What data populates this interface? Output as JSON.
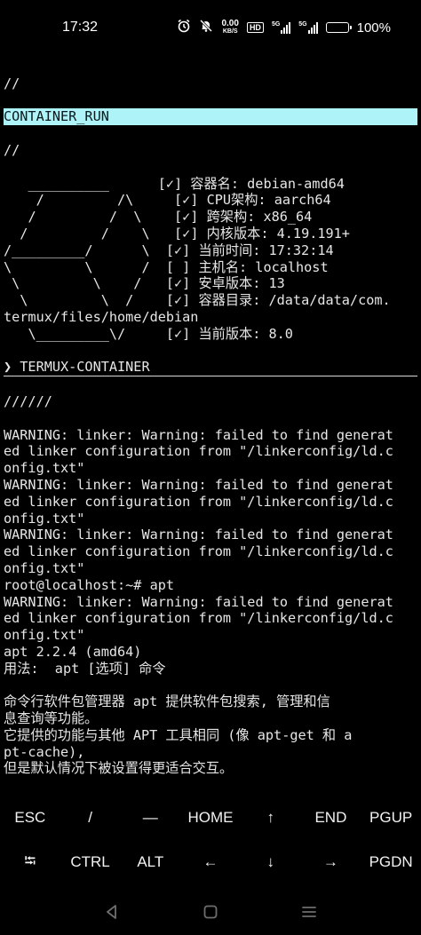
{
  "status_bar": {
    "time": "17:32",
    "net_speed_value": "0.00",
    "net_speed_unit": "KB/S",
    "hd_badge": "HD",
    "signal1_label": "5G",
    "signal2_label": "5G",
    "battery_percent": "100%",
    "battery_level": 1.0
  },
  "terminal": {
    "lines": [
      "",
      "//",
      "",
      "CONTAINER_RUN",
      "",
      "//",
      "",
      "   __________      [✓] 容器名: debian-amd64",
      "    /         /\\     [✓] CPU架构: aarch64",
      "   /         /  \\    [✓] 跨架构: x86_64",
      "  /         /    \\   [✓] 内核版本: 4.19.191+",
      "/_________/      \\  [✓] 当前时间: 17:32:14",
      "\\         \\      /  [ ] 主机名: localhost",
      " \\         \\    /   [✓] 安卓版本: 13",
      "  \\         \\  /    [✓] 容器目录: /data/data/com.",
      "termux/files/home/debian",
      "   \\_________\\/     [✓] 当前版本: 8.0",
      "",
      "❯ TERMUX-CONTAINER",
      "",
      "//////",
      "",
      "WARNING: linker: Warning: failed to find generat",
      "ed linker configuration from \"/linkerconfig/ld.c",
      "onfig.txt\"",
      "WARNING: linker: Warning: failed to find generat",
      "ed linker configuration from \"/linkerconfig/ld.c",
      "onfig.txt\"",
      "WARNING: linker: Warning: failed to find generat",
      "ed linker configuration from \"/linkerconfig/ld.c",
      "onfig.txt\"",
      "root@localhost:~# apt",
      "WARNING: linker: Warning: failed to find generat",
      "ed linker configuration from \"/linkerconfig/ld.c",
      "onfig.txt\"",
      "apt 2.2.4 (amd64)",
      "用法:  apt [选项] 命令",
      "",
      "命令行软件包管理器 apt 提供软件包搜索, 管理和信",
      "息查询等功能。",
      "它提供的功能与其他 APT 工具相同 (像 apt-get 和 a",
      "pt-cache),",
      "但是默认情况下被设置得更适合交互。"
    ],
    "highlight_line": "CONTAINER_RUN",
    "rule_after_line": "❯ TERMUX-CONTAINER"
  },
  "extra_keys": {
    "row1": [
      {
        "label": "ESC",
        "name": "esc-key"
      },
      {
        "label": "/",
        "name": "slash-key"
      },
      {
        "label": "—",
        "name": "dash-key"
      },
      {
        "label": "HOME",
        "name": "home-key"
      },
      {
        "label": "↑",
        "name": "up-arrow-key"
      },
      {
        "label": "END",
        "name": "end-key"
      },
      {
        "label": "PGUP",
        "name": "pgup-key"
      }
    ],
    "row2": [
      {
        "label": "⭾",
        "name": "tab-key"
      },
      {
        "label": "CTRL",
        "name": "ctrl-key"
      },
      {
        "label": "ALT",
        "name": "alt-key"
      },
      {
        "label": "←",
        "name": "left-arrow-key"
      },
      {
        "label": "↓",
        "name": "down-arrow-key"
      },
      {
        "label": "→",
        "name": "right-arrow-key"
      },
      {
        "label": "PGDN",
        "name": "pgdn-key"
      }
    ]
  },
  "nav_bar": {
    "icons": [
      "back-icon",
      "home-icon",
      "recents-icon"
    ]
  },
  "colors": {
    "background": "#000000",
    "terminal_text": "#e6e6e6",
    "highlight_bg": "#aef3f7",
    "nav_icon": "#6e6e6e"
  }
}
